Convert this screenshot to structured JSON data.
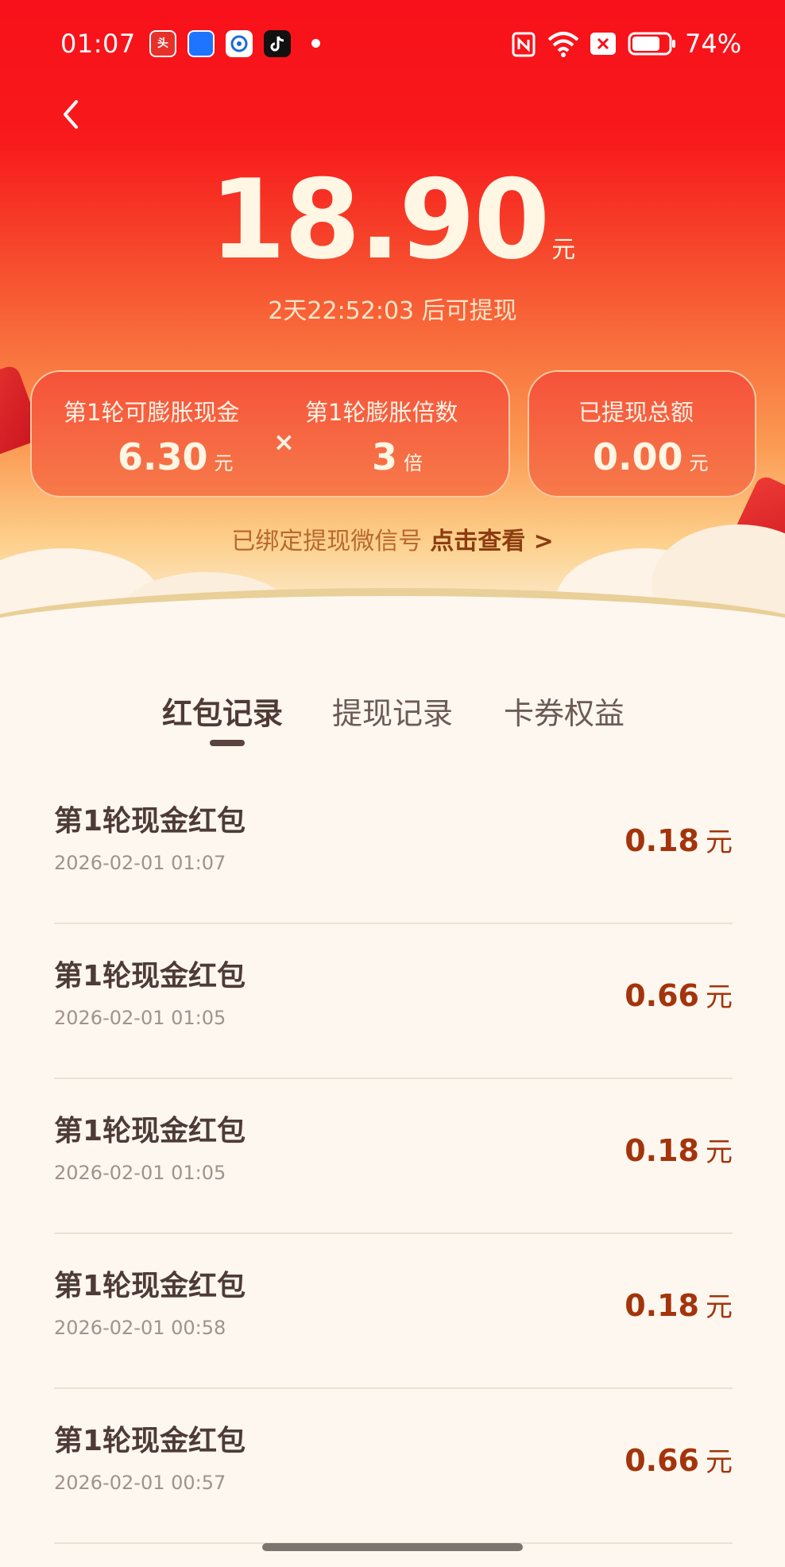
{
  "status_bar": {
    "time": "01:07",
    "battery_percent": "74%",
    "icons": [
      "toutiao-app-icon",
      "app-icon-blue",
      "app-icon-swirl",
      "tiktok-app-icon",
      "nfc-icon",
      "wifi-icon",
      "sim-off-icon",
      "battery-icon"
    ]
  },
  "header": {
    "amount": "18.90",
    "amount_unit": "元",
    "countdown": "2天22:52:03 后可提现",
    "round_cash_label": "第1轮可膨胀现金",
    "round_cash_value": "6.30",
    "round_cash_unit": "元",
    "multiply_symbol": "×",
    "multiplier_label": "第1轮膨胀倍数",
    "multiplier_value": "3",
    "multiplier_unit": "倍",
    "withdrawn_label": "已提现总额",
    "withdrawn_value": "0.00",
    "withdrawn_unit": "元",
    "bound_text": "已绑定提现微信号",
    "bound_link": "点击查看 >"
  },
  "tabs": [
    {
      "label": "红包记录",
      "active": true
    },
    {
      "label": "提现记录",
      "active": false
    },
    {
      "label": "卡券权益",
      "active": false
    }
  ],
  "records": [
    {
      "title": "第1轮现金红包",
      "time": "2026-02-01 01:07",
      "amount": "0.18",
      "unit": "元"
    },
    {
      "title": "第1轮现金红包",
      "time": "2026-02-01 01:05",
      "amount": "0.66",
      "unit": "元"
    },
    {
      "title": "第1轮现金红包",
      "time": "2026-02-01 01:05",
      "amount": "0.18",
      "unit": "元"
    },
    {
      "title": "第1轮现金红包",
      "time": "2026-02-01 00:58",
      "amount": "0.18",
      "unit": "元"
    },
    {
      "title": "第1轮现金红包",
      "time": "2026-02-01 00:57",
      "amount": "0.66",
      "unit": "元"
    }
  ],
  "colors": {
    "header_red": "#f8101a",
    "amount_text": "#fff6e4",
    "record_amount": "#a3340b",
    "page_bg": "#fdf7ef"
  }
}
